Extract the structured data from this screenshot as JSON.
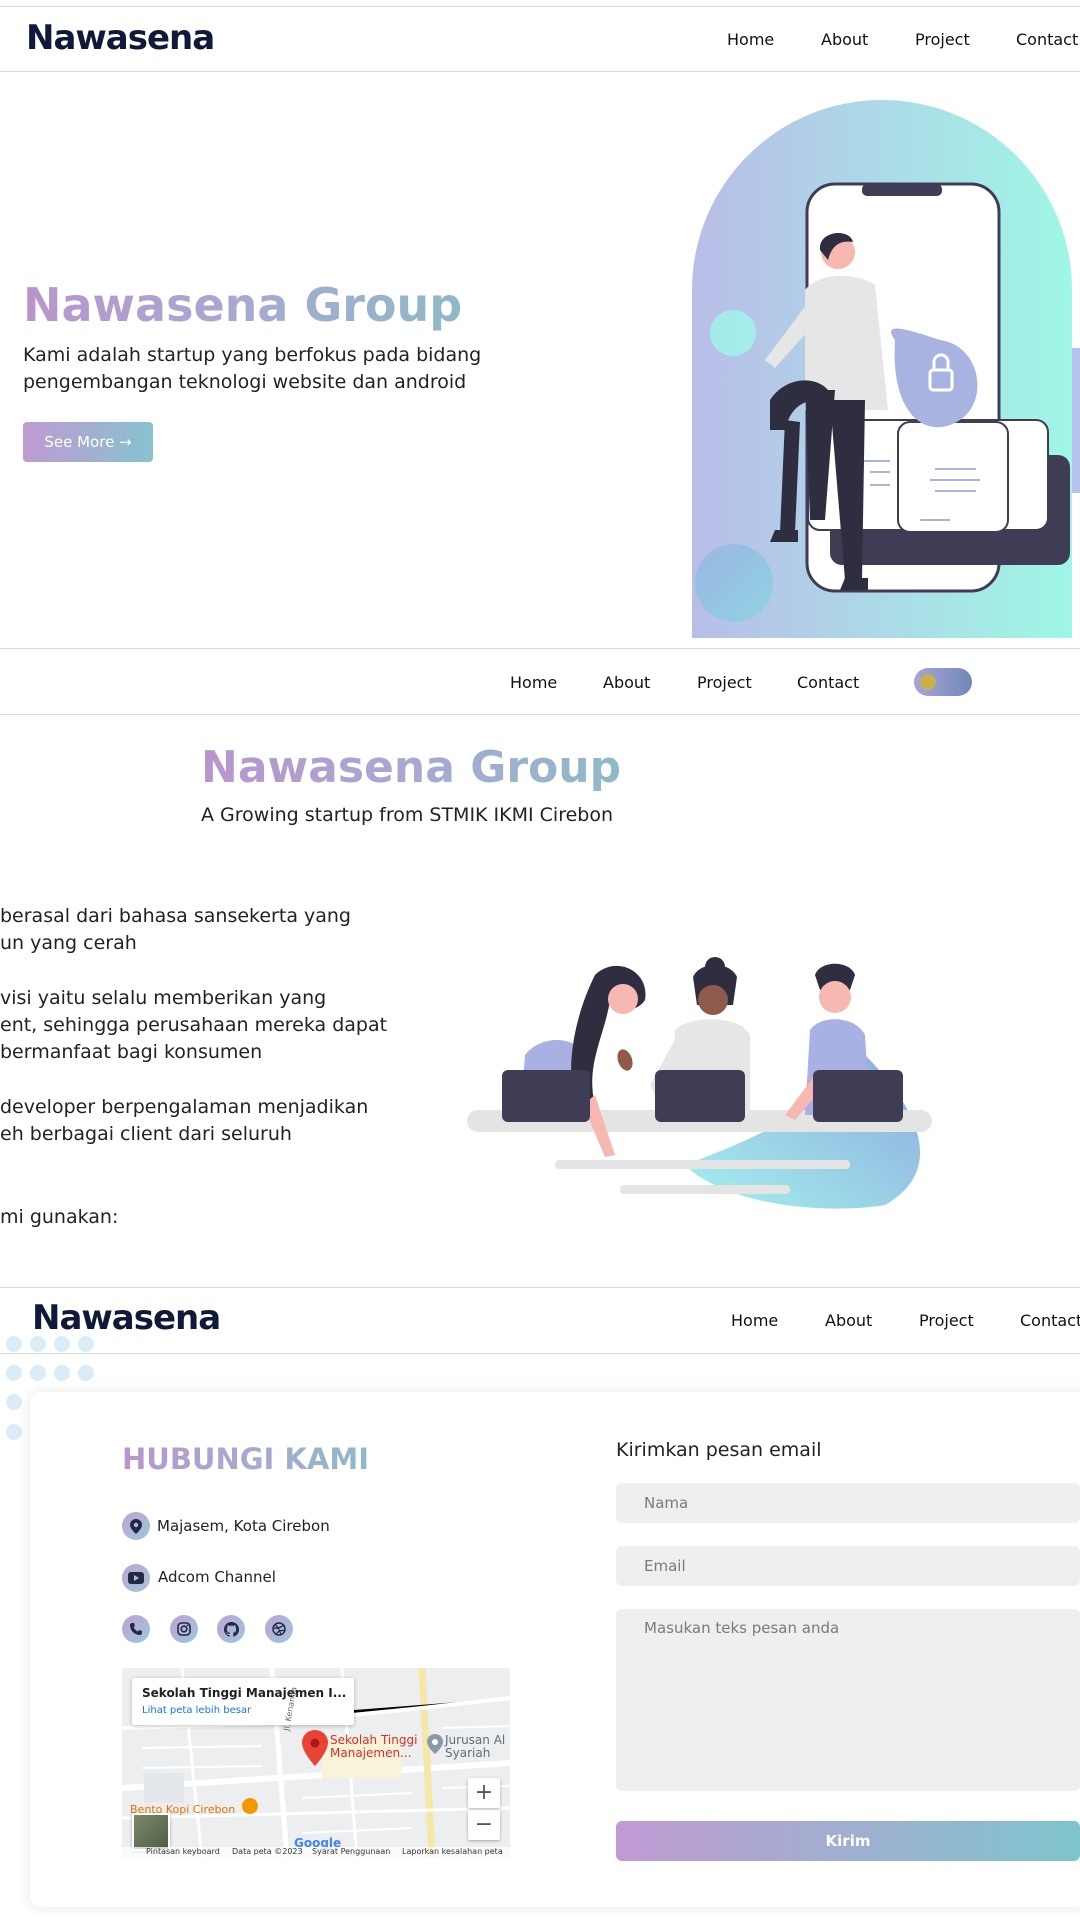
{
  "brand": "Nawasena",
  "nav": {
    "home": "Home",
    "about": "About",
    "project": "Project",
    "contact": "Contact"
  },
  "hero": {
    "title": "Nawasena Group",
    "line1": "Kami adalah startup yang berfokus pada bidang",
    "line2": "pengembangan teknologi website dan android",
    "button": "See More →"
  },
  "about": {
    "title": "Nawasena Group",
    "subtitle": "A Growing startup from STMIK IKMI Cirebon",
    "lines": [
      "berasal dari bahasa sansekerta yang",
      "un yang cerah",
      "visi yaitu selalu memberikan yang",
      "ent, sehingga perusahaan mereka dapat",
      "bermanfaat bagi konsumen",
      "developer berpengalaman menjadikan",
      "eh berbagai client dari seluruh",
      "mi gunakan:"
    ]
  },
  "contact": {
    "title": "HUBUNGI KAMI",
    "address": "Majasem, Kota Cirebon",
    "channel": "Adcom Channel",
    "form_title": "Kirimkan pesan email",
    "name_placeholder": "Nama",
    "email_placeholder": "Email",
    "message_placeholder": "Masukan teks pesan anda",
    "submit": "Kirim"
  },
  "map": {
    "place_title": "Sekolah Tinggi Manajemen I...",
    "place_link": "Lihat peta lebih besar",
    "pin_label_1": "Sekolah Tinggi",
    "pin_label_2": "Manajemen...",
    "side_label_1": "Jurusan Al",
    "side_label_2": "Syariah",
    "poi": "Bento Kopi Cirebon",
    "road": "Jl. Kenanga",
    "google": "Google",
    "footer": [
      "Pintasan keyboard",
      "Data peta ©2023",
      "Syarat Penggunaan",
      "Laporkan kesalahan peta"
    ]
  },
  "colors": {
    "brand_dark": "#0e1a3a",
    "gradient_start": "#b995cc",
    "gradient_end": "#7fc4cd"
  }
}
